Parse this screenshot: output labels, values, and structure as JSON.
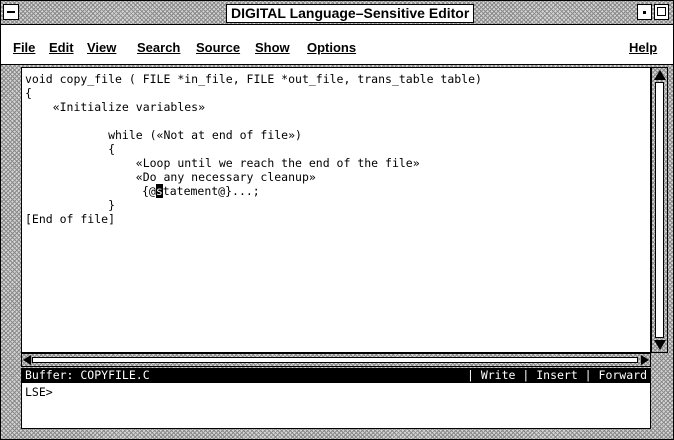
{
  "window": {
    "title": "DIGITAL Language–Sensitive Editor"
  },
  "menu": {
    "items": [
      {
        "label": "File"
      },
      {
        "label": "Edit"
      },
      {
        "label": "View"
      },
      {
        "label": "Search"
      },
      {
        "label": "Source"
      },
      {
        "label": "Show"
      },
      {
        "label": "Options"
      }
    ],
    "help": "Help"
  },
  "editor": {
    "lines": [
      "void copy_file ( FILE *in_file, FILE *out_file, trans_table table)",
      "{",
      "    «Initialize variables»",
      "",
      "            while («Not at end of file»)",
      "            {",
      "                «Loop until we reach the end of the file»",
      "                «Do any necessary cleanup»",
      "{@",
      "s",
      "tatement@}...;",
      "            }",
      "[End of file]"
    ]
  },
  "status": {
    "buffer": "Buffer: COPYFILE.C",
    "flags": "| Write | Insert | Forward"
  },
  "command": {
    "prompt": "LSE>"
  }
}
